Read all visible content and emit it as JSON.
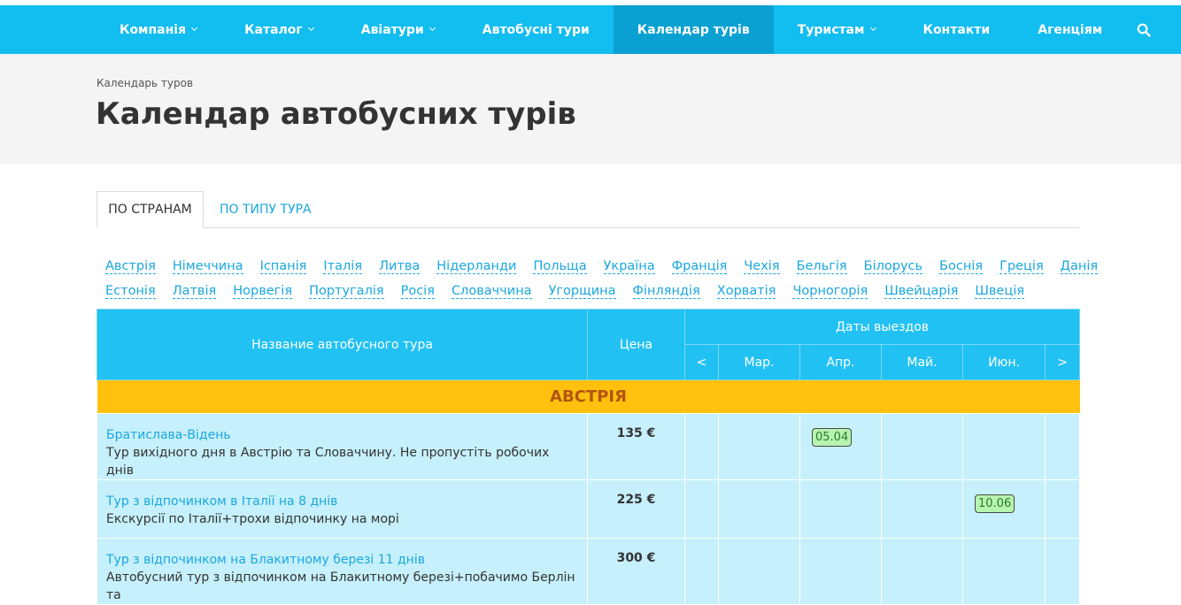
{
  "nav": {
    "items": [
      {
        "label": "Компанія",
        "dropdown": true
      },
      {
        "label": "Каталог",
        "dropdown": true
      },
      {
        "label": "Авіатури",
        "dropdown": true
      },
      {
        "label": "Автобусні тури",
        "dropdown": false
      },
      {
        "label": "Календар турів",
        "dropdown": false,
        "active": true
      },
      {
        "label": "Туристам",
        "dropdown": true
      },
      {
        "label": "Контакти",
        "dropdown": false
      },
      {
        "label": "Агенціям",
        "dropdown": false
      }
    ]
  },
  "breadcrumb": "Календарь туров",
  "page_title": "Календар автобусних турів",
  "tabs": {
    "active": "ПО СТРАНАМ",
    "other": "ПО ТИПУ ТУРА"
  },
  "countries": {
    "row1": [
      "Австрія",
      "Німеччина",
      "Іспанія",
      "Італія",
      "Литва",
      "Нідерланди",
      "Польща",
      "Україна",
      "Франція",
      "Чехія",
      "Бельгія",
      "Білорусь",
      "Боснія",
      "Греція",
      "Данія"
    ],
    "row2": [
      "Естонія",
      "Латвія",
      "Норвегія",
      "Португалія",
      "Росія",
      "Словаччина",
      "Угорщина",
      "Фінляндія",
      "Хорватія",
      "Чорногорія",
      "Швейцарія",
      "Швеція"
    ]
  },
  "table": {
    "col_name": "Название автобусного тура",
    "col_price": "Цена",
    "col_dates": "Даты выездов",
    "prev": "<",
    "next": ">",
    "months": [
      "Мар.",
      "Апр.",
      "Май.",
      "Июн."
    ],
    "group": "АВСТРІЯ",
    "rows": [
      {
        "name": "Братислава-Відень",
        "desc": "Тур вихідного дня в Австрію та Словаччину. Не пропустіть робочих днів",
        "price": "135 €",
        "date": "05.04"
      },
      {
        "name": "Тур з відпочинком в Італії на 8 днів",
        "desc": "Екскурсії по Італії+трохи відпочинку на морі",
        "price": "225 €",
        "date": "10.06"
      },
      {
        "name": "Тур з відпочинком на Блакитному березі 11 днів",
        "desc": "Автобусний тур з відпочинком на Блакитному березі+побачимо Берлін та",
        "price": "300 €"
      }
    ]
  }
}
